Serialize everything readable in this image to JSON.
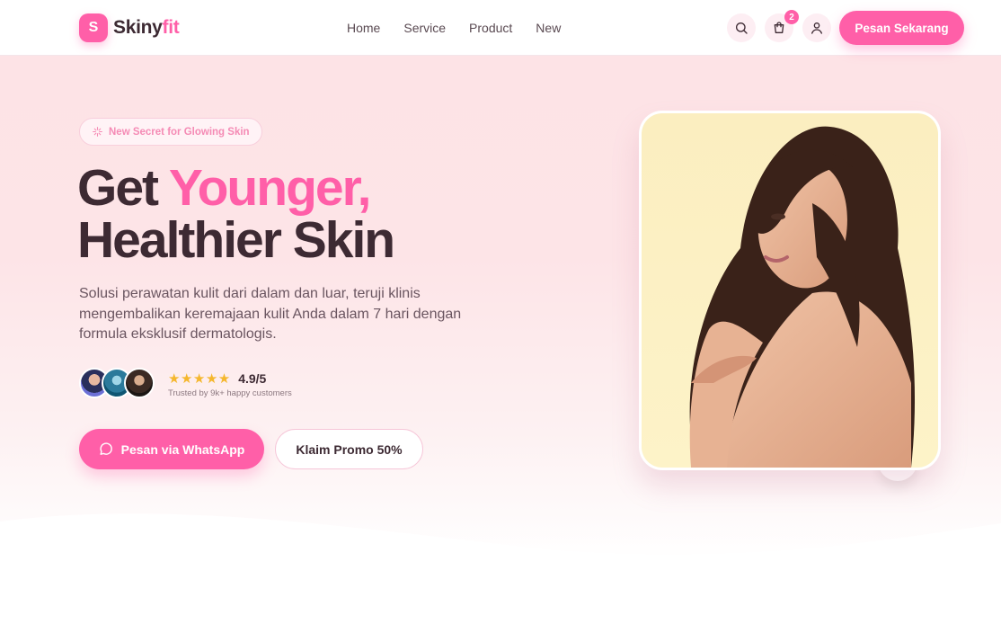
{
  "brand": {
    "mark": "S",
    "name_main": "Skiny",
    "name_accent": "fit"
  },
  "nav": {
    "items": [
      "Home",
      "Service",
      "Product",
      "New"
    ]
  },
  "header": {
    "cart_count": "2",
    "cta_label": "Pesan Sekarang"
  },
  "hero": {
    "pill_label": "New Secret for Glowing Skin",
    "headline_part1": "Get ",
    "headline_accent": "Younger,",
    "headline_line2": "Healthier Skin",
    "description": "Solusi perawatan kulit dari dalam dan luar, teruji klinis mengembalikan keremajaan kulit Anda dalam 7 hari dengan formula eksklusif dermatologis.",
    "stars": "★★★★★",
    "rating": "4.9/5",
    "trusted": "Trusted by 9k+ happy customers",
    "whatsapp_label": "Pesan via WhatsApp",
    "promo_label": "Klaim Promo 50%"
  },
  "colors": {
    "accent": "#ff5fa8",
    "text": "#3d2a33",
    "hero_bg": "#fde3e6",
    "star": "#f5b72d"
  },
  "icons": [
    "search-icon",
    "cart-icon",
    "user-icon",
    "sparkle-icon",
    "whatsapp-icon"
  ]
}
